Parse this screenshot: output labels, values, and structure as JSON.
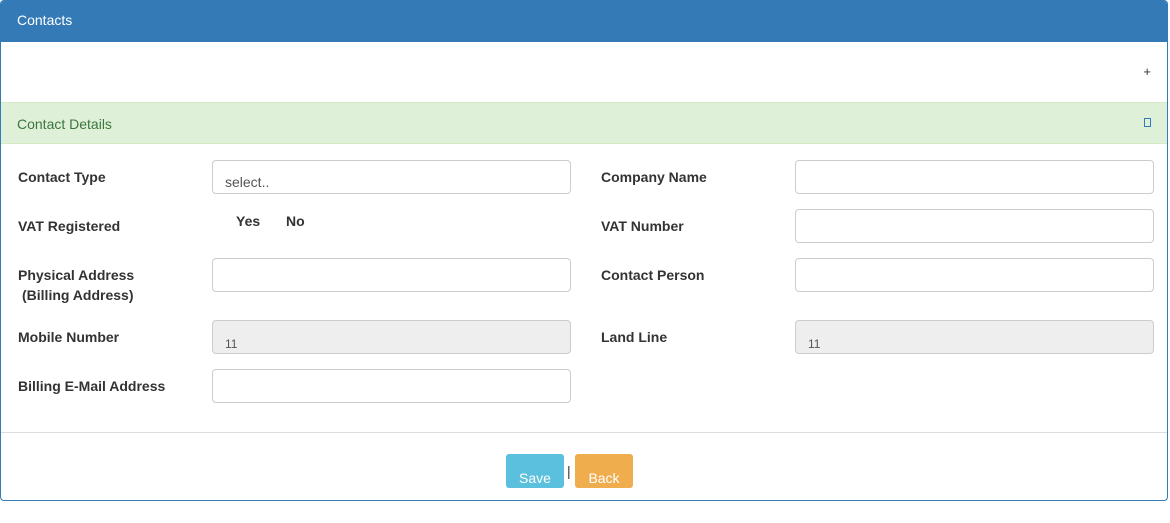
{
  "panel": {
    "title": "Contacts",
    "expand_symbol": "+"
  },
  "section": {
    "title": "Contact Details"
  },
  "form": {
    "contact_type_label": "Contact Type",
    "contact_type_value": "select..",
    "company_name_label": "Company Name",
    "company_name_value": "",
    "vat_registered_label": "VAT Registered",
    "vat_yes_label": "Yes",
    "vat_no_label": "No",
    "vat_number_label": "VAT Number",
    "vat_number_value": "",
    "physical_address_label_line1": "Physical Address",
    "physical_address_label_line2": "(Billing Address)",
    "physical_address_value": "",
    "contact_person_label": "Contact Person",
    "contact_person_value": "",
    "mobile_number_label": "Mobile Number",
    "mobile_number_value": "11",
    "land_line_label": "Land Line",
    "land_line_value": "11",
    "billing_email_label": "Billing E-Mail Address",
    "billing_email_value": ""
  },
  "actions": {
    "save_label": "Save",
    "separator": "|",
    "back_label": "Back"
  },
  "colors": {
    "primary": "#337ab7",
    "success_bg": "#dff0d8",
    "success_text": "#3c763d",
    "info": "#5bc0de",
    "warning": "#f0ad4e"
  }
}
